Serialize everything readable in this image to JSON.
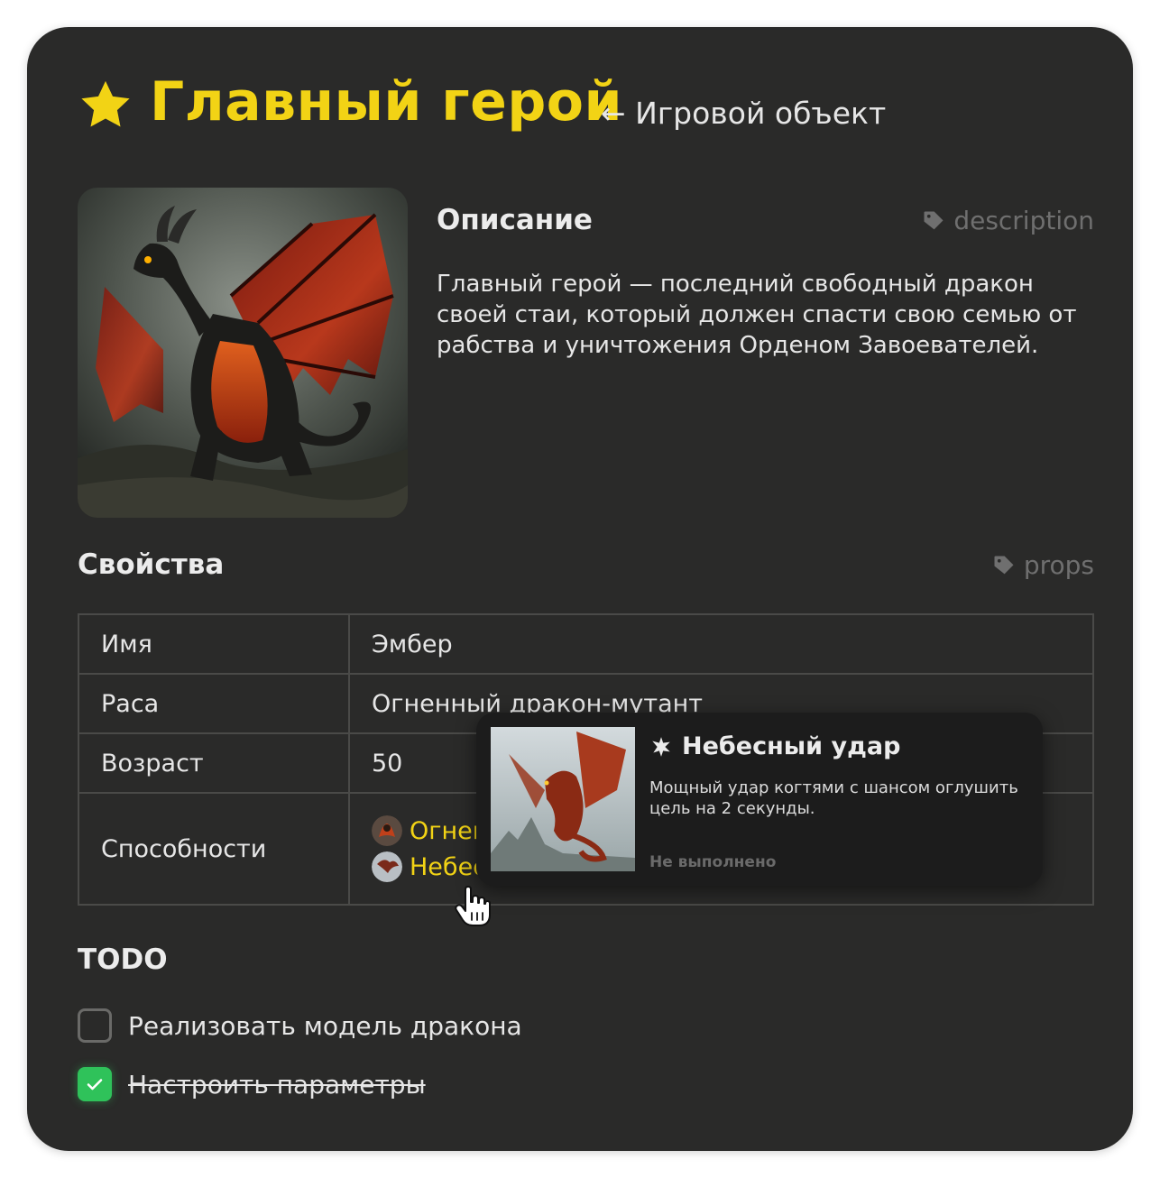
{
  "header": {
    "title": "Главный герой",
    "parent_link": "← Игровой объект"
  },
  "description": {
    "heading": "Описание",
    "tag": "description",
    "text": "Главный герой — последний свободный дракон своей стаи, который должен спасти свою семью от рабства и уничтожения Орденом Завоевателей."
  },
  "props": {
    "heading": "Свойства",
    "tag": "props",
    "rows": {
      "name": {
        "key": "Имя",
        "value": "Эмбер"
      },
      "race": {
        "key": "Раса",
        "value": "Огненный дракон-мутант"
      },
      "age": {
        "key": "Возраст",
        "value": "50"
      },
      "abilities": {
        "key": "Способности",
        "items": [
          "Огненное дыхание",
          "Небесный удар"
        ]
      }
    }
  },
  "todo": {
    "heading": "TODO",
    "items": [
      {
        "label": "Реализовать модель дракона",
        "checked": false
      },
      {
        "label": "Настроить параметры",
        "checked": true
      }
    ]
  },
  "tooltip": {
    "title": "Небесный удар",
    "description": "Мощный удар когтями с шансом оглушить цель на 2 секунды.",
    "status": "Не выполнено"
  },
  "colors": {
    "accent": "#f2d315",
    "card_bg": "#2a2a29",
    "check_green": "#2fc25a"
  },
  "icons": [
    "star-icon",
    "arrow-left-icon",
    "tag-icon",
    "sparkle-icon",
    "check-icon",
    "hand-cursor-icon"
  ]
}
